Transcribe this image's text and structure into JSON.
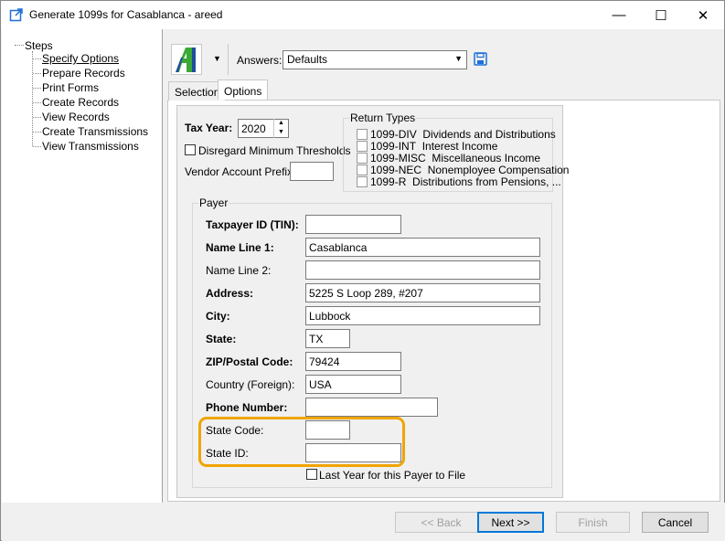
{
  "window": {
    "title": "Generate 1099s for Casablanca - areed",
    "minimize": "—",
    "maximize": "☐",
    "close": "✕"
  },
  "tree": {
    "root": "Steps",
    "items": [
      {
        "label": "Specify Options",
        "selected": true
      },
      {
        "label": "Prepare Records"
      },
      {
        "label": "Print Forms"
      },
      {
        "label": "Create Records"
      },
      {
        "label": "View Records"
      },
      {
        "label": "Create Transmissions"
      },
      {
        "label": "View Transmissions"
      }
    ]
  },
  "toolbar": {
    "answers_label": "Answers:",
    "answers_value": "Defaults",
    "logo_icon": "app-logo-icon",
    "save_icon": "save-icon"
  },
  "tabs": [
    {
      "label": "Selection"
    },
    {
      "label": "Options",
      "active": true
    }
  ],
  "options": {
    "tax_year_label": "Tax Year:",
    "tax_year_value": "2020",
    "disregard_label": "Disregard Minimum Thresholds",
    "vendor_prefix_label": "Vendor Account Prefix:",
    "vendor_prefix_value": "",
    "return_types_title": "Return Types",
    "return_types": [
      {
        "code": "1099-DIV",
        "desc": "Dividends and Distributions"
      },
      {
        "code": "1099-INT",
        "desc": "Interest Income"
      },
      {
        "code": "1099-MISC",
        "desc": "Miscellaneous Income"
      },
      {
        "code": "1099-NEC",
        "desc": "Nonemployee Compensation"
      },
      {
        "code": "1099-R",
        "desc": "Distributions from Pensions, ..."
      }
    ]
  },
  "payer": {
    "title": "Payer",
    "tin_label": "Taxpayer ID (TIN):",
    "tin_value": "",
    "name1_label": "Name Line 1:",
    "name1_value": "Casablanca",
    "name2_label": "Name Line 2:",
    "name2_value": "",
    "address_label": "Address:",
    "address_value": "5225 S Loop 289, #207",
    "city_label": "City:",
    "city_value": "Lubbock",
    "state_label": "State:",
    "state_value": "TX",
    "zip_label": "ZIP/Postal Code:",
    "zip_value": "79424",
    "country_label": "Country (Foreign):",
    "country_value": "USA",
    "phone_label": "Phone Number:",
    "phone_value": "",
    "state_code_label": "State Code:",
    "state_code_value": "",
    "state_id_label": "State ID:",
    "state_id_value": "",
    "last_year_label": "Last Year for this Payer to File"
  },
  "footer": {
    "back": "<< Back",
    "next": "Next >>",
    "finish": "Finish",
    "cancel": "Cancel"
  },
  "colors": {
    "highlight": "#f0a500",
    "logo_green": "#3aa935",
    "logo_blue": "#1f4e9c",
    "save_blue": "#1e6fd9"
  }
}
